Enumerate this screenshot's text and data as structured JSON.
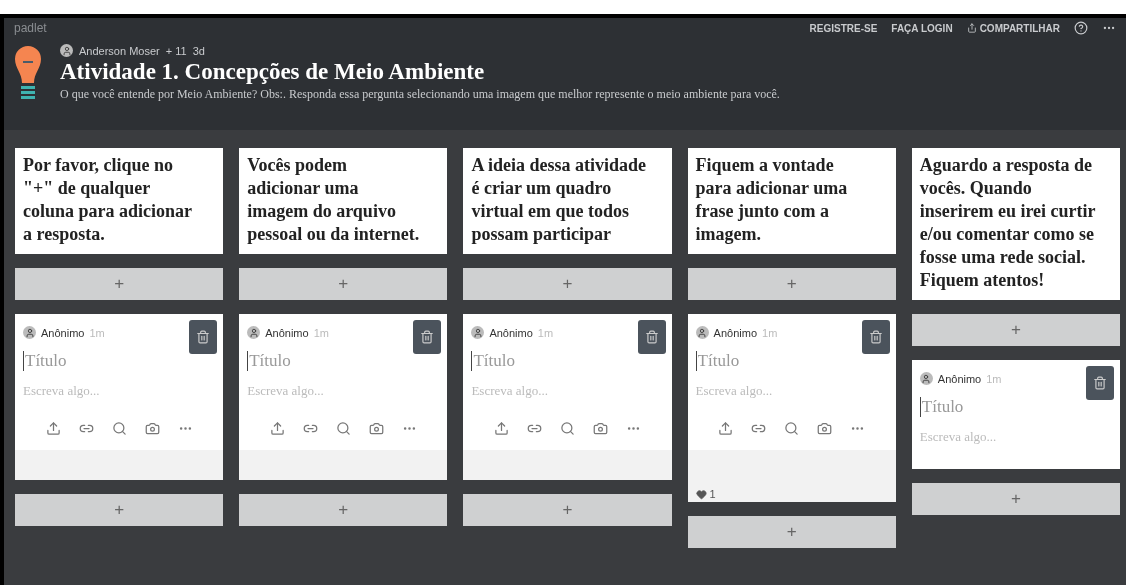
{
  "topbar": {
    "brand": "padlet",
    "links": [
      "REGISTRE-SE",
      "FAÇA LOGIN"
    ],
    "share": "COMPARTILHAR"
  },
  "header": {
    "author": "Anderson Moser",
    "contributors": "+ 11",
    "age": "3d",
    "title": "Atividade 1. Concepções de Meio Ambiente",
    "description": "O que você entende por Meio Ambiente? Obs:. Responda essa pergunta selecionando uma imagem que melhor represente o meio ambiente para você."
  },
  "columns": [
    {
      "items": [
        {
          "kind": "header",
          "text": "Por favor, clique no \"+\" de qualquer coluna para adicionar a resposta."
        },
        {
          "kind": "add",
          "text": "+"
        },
        {
          "kind": "post",
          "author": "Anônimo",
          "time": "1m",
          "title_placeholder": "Título",
          "body_placeholder": "Escreva algo...",
          "toolbar": true
        },
        {
          "kind": "add",
          "text": "+"
        }
      ]
    },
    {
      "items": [
        {
          "kind": "header",
          "text": "Vocês podem adicionar uma imagem do arquivo pessoal ou da internet."
        },
        {
          "kind": "add",
          "text": "+"
        },
        {
          "kind": "post",
          "author": "Anônimo",
          "time": "1m",
          "title_placeholder": "Título",
          "body_placeholder": "Escreva algo...",
          "toolbar": true
        },
        {
          "kind": "add",
          "text": "+"
        }
      ]
    },
    {
      "items": [
        {
          "kind": "header",
          "text": "A ideia dessa atividade é criar um quadro virtual em que todos possam participar"
        },
        {
          "kind": "add",
          "text": "+"
        },
        {
          "kind": "post",
          "author": "Anônimo",
          "time": "1m",
          "title_placeholder": "Título",
          "body_placeholder": "Escreva algo...",
          "toolbar": true
        },
        {
          "kind": "add",
          "text": "+"
        }
      ]
    },
    {
      "items": [
        {
          "kind": "header",
          "text": "Fiquem a vontade para adicionar uma frase junto com a imagem."
        },
        {
          "kind": "add",
          "text": "+"
        },
        {
          "kind": "post",
          "author": "Anônimo",
          "time": "1m",
          "title_placeholder": "Título",
          "body_placeholder": "Escreva algo...",
          "toolbar": true,
          "likes": "1"
        },
        {
          "kind": "add",
          "text": "+"
        }
      ]
    },
    {
      "items": [
        {
          "kind": "header",
          "text": "Aguardo a resposta de vocês. Quando inserirem eu irei curtir e/ou comentar como se fosse uma rede social. Fiquem atentos!"
        },
        {
          "kind": "add",
          "text": "+"
        },
        {
          "kind": "post",
          "author": "Anônimo",
          "time": "1m",
          "title_placeholder": "Título",
          "body_placeholder": "Escreva algo...",
          "toolbar": false
        },
        {
          "kind": "add",
          "text": "+"
        }
      ]
    }
  ]
}
